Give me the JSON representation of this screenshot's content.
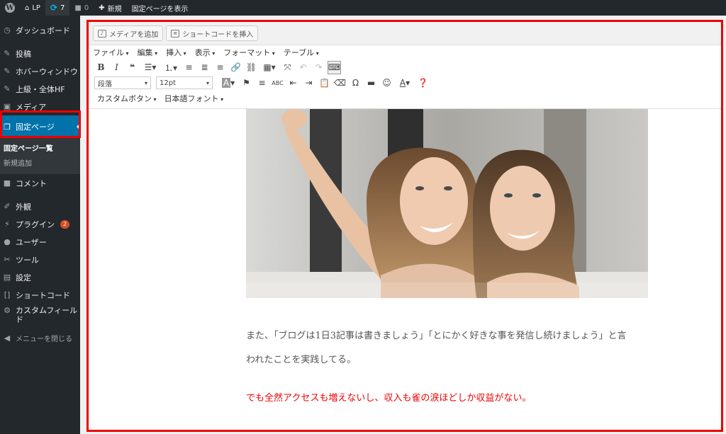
{
  "adminbar": {
    "site_name": "LP",
    "updates_count": "7",
    "comments_count": "0",
    "new_label": "新規",
    "view_page_label": "固定ページを表示"
  },
  "sidebar": {
    "items": [
      {
        "label": "ダッシュボード",
        "icon": "dashboard-icon"
      },
      {
        "label": "投稿",
        "icon": "pin-icon"
      },
      {
        "label": "ホバーウィンドウ",
        "icon": "pin-icon"
      },
      {
        "label": "上級・全体HF",
        "icon": "pin-icon"
      },
      {
        "label": "メディア",
        "icon": "media-icon"
      },
      {
        "label": "固定ページ",
        "icon": "pages-icon"
      },
      {
        "label": "コメント",
        "icon": "comment-icon"
      },
      {
        "label": "外観",
        "icon": "brush-icon"
      },
      {
        "label": "プラグイン",
        "icon": "plugin-icon",
        "badge": "2"
      },
      {
        "label": "ユーザー",
        "icon": "user-icon"
      },
      {
        "label": "ツール",
        "icon": "wrench-icon"
      },
      {
        "label": "設定",
        "icon": "settings-icon"
      },
      {
        "label": "ショートコード",
        "icon": "brackets-icon"
      },
      {
        "label": "カスタムフィールド",
        "icon": "gear-icon"
      }
    ],
    "submenu": [
      "固定ページ一覧",
      "新規追加"
    ],
    "collapse_label": "メニューを閉じる"
  },
  "editor": {
    "add_media_label": "メディアを追加",
    "insert_shortcode_label": "ショートコードを挿入",
    "menus": [
      "ファイル",
      "編集",
      "挿入",
      "表示",
      "フォーマット",
      "テーブル"
    ],
    "format_select": "段落",
    "size_select": "12pt",
    "custom_button_label": "カスタムボタン",
    "japanese_font_label": "日本語フォント"
  },
  "content": {
    "paragraph1_line1": "また、「ブログは1日3記事は書きましょう」「とにかく好きな事を発信し続けましょう」と言",
    "paragraph1_line2": "われたことを実践してる。",
    "paragraph2": "でも全然アクセスも増えないし、収入も雀の涙ほどしか収益がない。"
  },
  "colors": {
    "highlight": "#ee0000",
    "accent": "#0073aa",
    "text_red": "#ee0000"
  }
}
